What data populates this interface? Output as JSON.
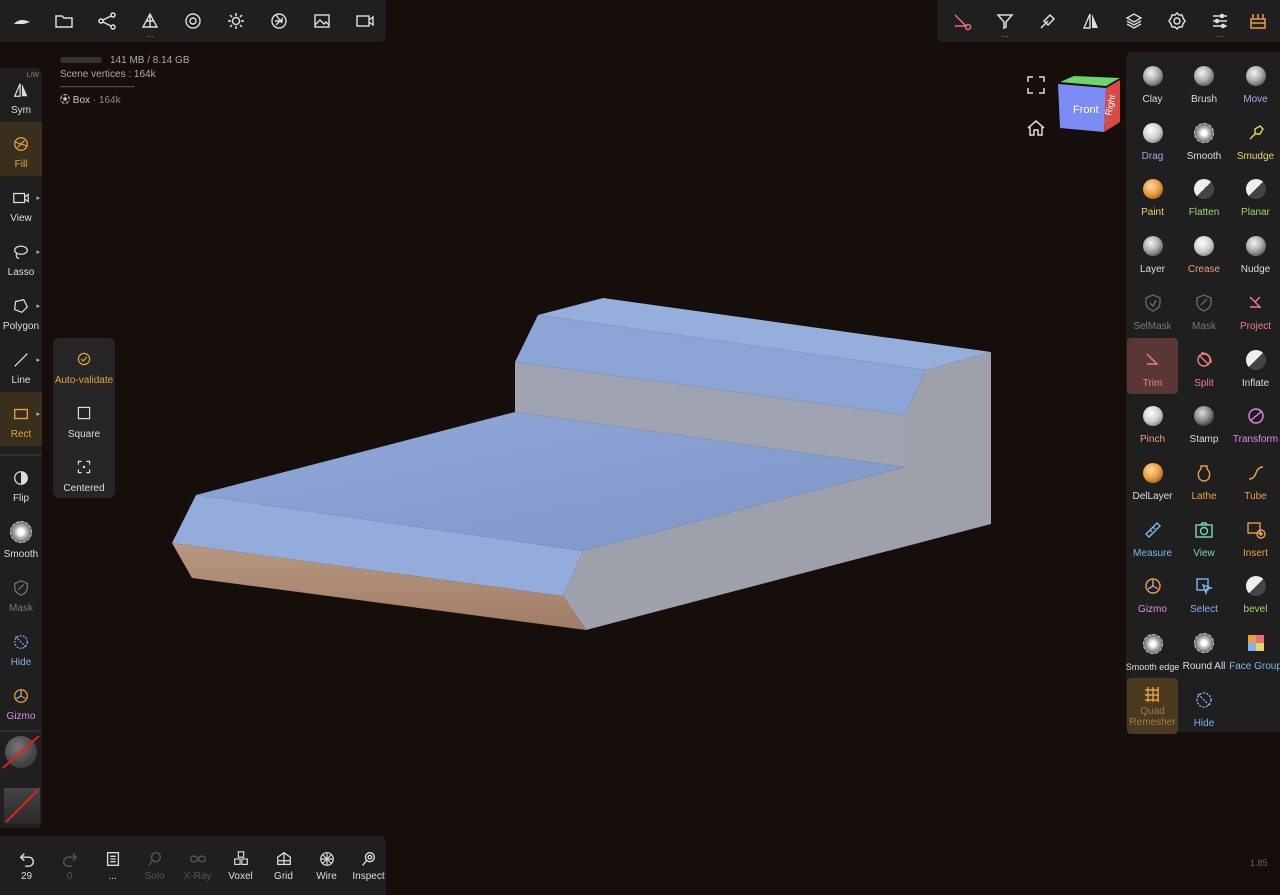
{
  "stats": {
    "memory": "141 MB / 8.14 GB",
    "scene_vertices": "Scene vertices : 164k",
    "separator": "----------------------------",
    "object_name": "Box",
    "object_vertices": "· 164k"
  },
  "left_tools": [
    {
      "label": "Sym",
      "badge": "L/W"
    },
    {
      "label": "Fill"
    },
    {
      "label": "View"
    },
    {
      "label": "Lasso"
    },
    {
      "label": "Polygon"
    },
    {
      "label": "Line"
    },
    {
      "label": "Rect"
    },
    {
      "label": "Flip"
    },
    {
      "label": "Smooth"
    },
    {
      "label": "Mask"
    },
    {
      "label": "Hide"
    },
    {
      "label": "Gizmo"
    }
  ],
  "rect_options": [
    {
      "label": "Auto-validate"
    },
    {
      "label": "Square"
    },
    {
      "label": "Centered"
    }
  ],
  "bottom_bar": {
    "undo_label": "29",
    "redo_label": "0",
    "history_label": "...",
    "solo_label": "Solo",
    "xray_label": "X-Ray",
    "voxel_label": "Voxel",
    "grid_label": "Grid",
    "wire_label": "Wire",
    "inspect_label": "Inspect"
  },
  "nav_cube": {
    "front": "Front",
    "right": "Right"
  },
  "right_tools": [
    {
      "label": "Clay",
      "color": "#dddddd"
    },
    {
      "label": "Brush",
      "color": "#dddddd"
    },
    {
      "label": "Move",
      "color": "#a9a6e8"
    },
    {
      "label": "Drag",
      "color": "#a9a6e8"
    },
    {
      "label": "Smooth",
      "color": "#dddddd"
    },
    {
      "label": "Smudge",
      "color": "#e8d36a"
    },
    {
      "label": "Paint",
      "color": "#e8d36a"
    },
    {
      "label": "Flatten",
      "color": "#9fd76a"
    },
    {
      "label": "Planar",
      "color": "#9fd76a"
    },
    {
      "label": "Layer",
      "color": "#dddddd"
    },
    {
      "label": "Crease",
      "color": "#e8a07a"
    },
    {
      "label": "Nudge",
      "color": "#dddddd"
    },
    {
      "label": "SelMask",
      "color": "#777777"
    },
    {
      "label": "Mask",
      "color": "#777777"
    },
    {
      "label": "Project",
      "color": "#f08080"
    },
    {
      "label": "Trim",
      "color": "#f08080"
    },
    {
      "label": "Split",
      "color": "#f08080"
    },
    {
      "label": "Inflate",
      "color": "#dddddd"
    },
    {
      "label": "Pinch",
      "color": "#e8a07a"
    },
    {
      "label": "Stamp",
      "color": "#dddddd"
    },
    {
      "label": "Transform",
      "color": "#e28ae8"
    },
    {
      "label": "DelLayer",
      "color": "#dddddd"
    },
    {
      "label": "Lathe",
      "color": "#e8a040"
    },
    {
      "label": "Tube",
      "color": "#e8a040"
    },
    {
      "label": "Measure",
      "color": "#7fb4f0"
    },
    {
      "label": "View",
      "color": "#7fd6c0"
    },
    {
      "label": "Insert",
      "color": "#e8a040"
    },
    {
      "label": "Gizmo",
      "color": "#e28ae8"
    },
    {
      "label": "Select",
      "color": "#7fb4f0"
    },
    {
      "label": "bevel",
      "color": "#9fd76a"
    },
    {
      "label": "Smooth edge",
      "color": "#dddddd"
    },
    {
      "label": "Round All",
      "color": "#dddddd"
    },
    {
      "label": "Face Group",
      "color": "#7fb4f0"
    },
    {
      "label": "Quad Remesher",
      "color": "#a07a40"
    },
    {
      "label": "Hide",
      "color": "#7fb4f0"
    }
  ],
  "version": "1.85"
}
